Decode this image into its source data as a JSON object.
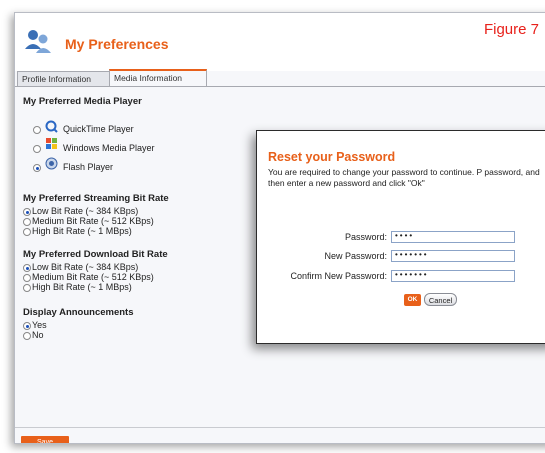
{
  "figure_label": "Figure 7",
  "header": {
    "title": "My Preferences"
  },
  "tabs": [
    {
      "label": "Profile Information"
    },
    {
      "label": "Media Information"
    }
  ],
  "sections": {
    "media_player": {
      "heading": "My Preferred Media Player",
      "options": [
        {
          "label": "QuickTime Player",
          "icon": "quicktime-icon",
          "selected": false
        },
        {
          "label": "Windows Media Player",
          "icon": "windows-media-icon",
          "selected": false
        },
        {
          "label": "Flash Player",
          "icon": "flash-icon",
          "selected": true
        }
      ]
    },
    "streaming": {
      "heading": "My Preferred Streaming Bit Rate",
      "options": [
        {
          "label": "Low Bit Rate (~ 384 KBps)",
          "selected": true
        },
        {
          "label": "Medium Bit Rate (~ 512 KBps)",
          "selected": false
        },
        {
          "label": "High Bit Rate (~ 1 MBps)",
          "selected": false
        }
      ]
    },
    "download": {
      "heading": "My Preferred Download Bit Rate",
      "options": [
        {
          "label": "Low Bit Rate (~ 384 KBps)",
          "selected": true
        },
        {
          "label": "Medium Bit Rate (~ 512 KBps)",
          "selected": false
        },
        {
          "label": "High Bit Rate (~ 1 MBps)",
          "selected": false
        }
      ]
    },
    "announcements": {
      "heading": "Display Announcements",
      "options": [
        {
          "label": "Yes",
          "selected": true
        },
        {
          "label": "No",
          "selected": false
        }
      ]
    }
  },
  "save_label": "Save",
  "modal": {
    "title": "Reset your Password",
    "description": "You are required to change your password to continue. P password, and then enter a new password and click \"Ok\"",
    "fields": {
      "password": {
        "label": "Password:",
        "value": "••••"
      },
      "new_password": {
        "label": "New Password:",
        "value": "•••••••"
      },
      "confirm_password": {
        "label": "Confirm New Password:",
        "value": "•••••••"
      }
    },
    "ok_label": "OK",
    "cancel_label": "Cancel"
  },
  "colors": {
    "accent": "#e8601a",
    "figure_label": "#e8211b",
    "radio_selected": "#1b4fb8"
  }
}
